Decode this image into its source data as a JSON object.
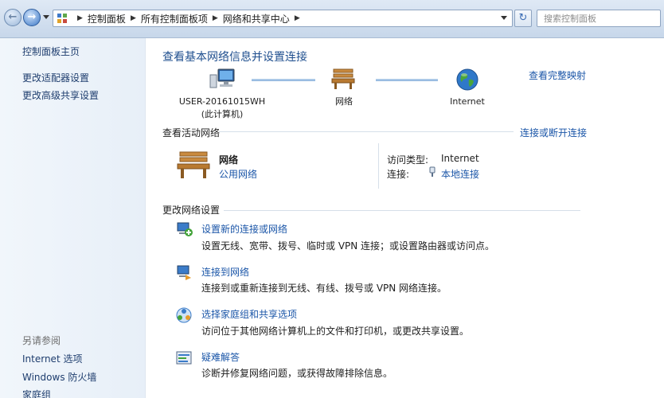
{
  "address_bar": {
    "crumbs": [
      "控制面板",
      "所有控制面板项",
      "网络和共享中心"
    ]
  },
  "search": {
    "placeholder": "搜索控制面板"
  },
  "sidebar": {
    "links": [
      "控制面板主页",
      "更改适配器设置",
      "更改高级共享设置"
    ],
    "see_also_label": "另请参阅",
    "see_also": [
      "Internet 选项",
      "Windows 防火墙",
      "家庭组"
    ]
  },
  "main": {
    "title": "查看基本网络信息并设置连接",
    "map_link": "查看完整映射",
    "computer_name": "USER-20161015WH",
    "computer_sub": "(此计算机)",
    "network_node": "网络",
    "internet_node": "Internet",
    "active_label": "查看活动网络",
    "connect_link": "连接或断开连接",
    "network_name": "网络",
    "network_type": "公用网络",
    "access_type_label": "访问类型:",
    "access_type_value": "Internet",
    "connections_label": "连接:",
    "connections_value": "本地连接",
    "change_label": "更改网络设置",
    "tasks": [
      {
        "title": "设置新的连接或网络",
        "desc": "设置无线、宽带、拨号、临时或 VPN 连接；或设置路由器或访问点。"
      },
      {
        "title": "连接到网络",
        "desc": "连接到或重新连接到无线、有线、拨号或 VPN 网络连接。"
      },
      {
        "title": "选择家庭组和共享选项",
        "desc": "访问位于其他网络计算机上的文件和打印机，或更改共享设置。"
      },
      {
        "title": "疑难解答",
        "desc": "诊断并修复网络问题，或获得故障排除信息。"
      }
    ]
  }
}
